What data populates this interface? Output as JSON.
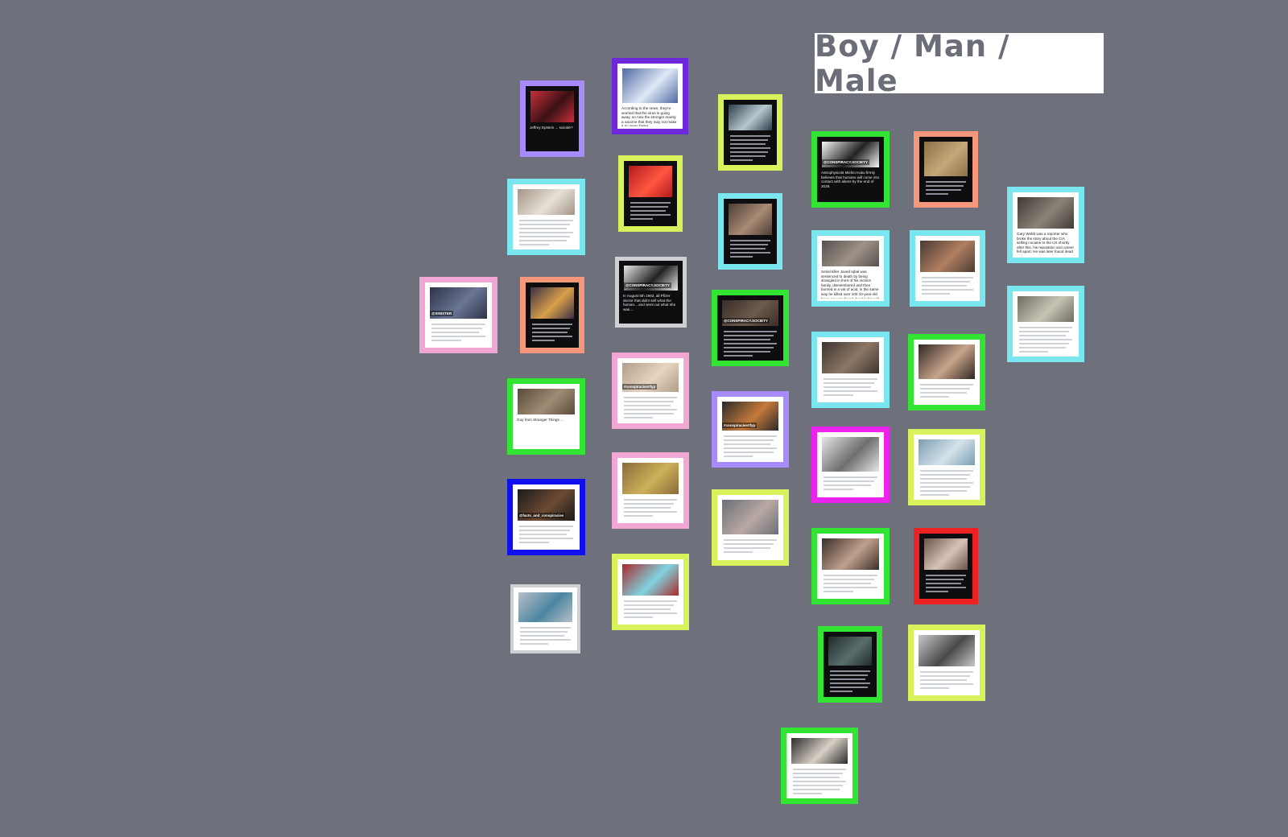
{
  "page": {
    "title": "Boy / Man / Male",
    "background": "#6e717b"
  },
  "cards": [
    {
      "id": "c1",
      "frame": "#a78bfa",
      "dark": true,
      "caption": "Jeffrey Epstein ... suicide?"
    },
    {
      "id": "c2",
      "frame": "#6d28d9",
      "dark": false,
      "caption": "According to the news, they're worried that the virus is going away, so now the stronger mainly a vaccine that they may not make it go away faster."
    },
    {
      "id": "c3",
      "frame": "#d9f25c",
      "dark": true,
      "caption": ""
    },
    {
      "id": "c4",
      "frame": "#79e6f0",
      "dark": false,
      "caption": ""
    },
    {
      "id": "c5",
      "frame": "#d9f25c",
      "dark": true,
      "caption": ""
    },
    {
      "id": "c6",
      "frame": "#79e6f0",
      "dark": true,
      "caption": ""
    },
    {
      "id": "c7",
      "frame": "#33e533",
      "dark": true,
      "caption": "Astrophysicist Michio Kaku firmly believes that humans will come into contact with aliens by the end of 2029.",
      "tag": "@CONSPIRACY.SOCIETY"
    },
    {
      "id": "c8",
      "frame": "#f5977a",
      "dark": true,
      "caption": ""
    },
    {
      "id": "c9",
      "frame": "#79e6f0",
      "dark": false,
      "caption": "Gary Webb was a reporter who broke the story about the CIA selling cocaine to the US shortly after this, his reputation and career fell apart. He was later found dead with two gunshots to the head. It was labeled as a suicide."
    },
    {
      "id": "c10",
      "frame": "#f2a6d4",
      "dark": false,
      "caption": "",
      "tag": "@SINISTER"
    },
    {
      "id": "c11",
      "frame": "#f5977a",
      "dark": true,
      "caption": ""
    },
    {
      "id": "c12",
      "frame": "#cfd0d4",
      "dark": true,
      "caption": "In August 5th 1963, all Pfizer doctor that didnt sell what the human... and went out what she was....",
      "tag": "@CONSPIRACY.SOCIETY"
    },
    {
      "id": "c13",
      "frame": "#33e533",
      "dark": true,
      "caption": "",
      "tag": "@CONSPIRACY.SOCIETY"
    },
    {
      "id": "c14",
      "frame": "#79e6f0",
      "dark": false,
      "caption": "Serial killer Javed Iqbal was sentenced to death by being strangled in front of his victims family, dismembered and then burned in a vat of acid, in the same way he killed over 100 10-year-old boys. He was found dead in his cell before the execution could be carried out."
    },
    {
      "id": "c15",
      "frame": "#79e6f0",
      "dark": false,
      "caption": ""
    },
    {
      "id": "c16",
      "frame": "#79e6f0",
      "dark": false,
      "caption": ""
    },
    {
      "id": "c17",
      "frame": "#33e533",
      "dark": false,
      "caption": "Guy from Stranger Things ..."
    },
    {
      "id": "c18",
      "frame": "#f2a6d4",
      "dark": false,
      "caption": "",
      "tag": "#conspiracies#fyp"
    },
    {
      "id": "c19",
      "frame": "#a78bfa",
      "dark": false,
      "caption": "",
      "tag": "#conspiracies#fyp"
    },
    {
      "id": "c20",
      "frame": "#79e6f0",
      "dark": false,
      "caption": ""
    },
    {
      "id": "c21",
      "frame": "#33e533",
      "dark": false,
      "caption": ""
    },
    {
      "id": "c22",
      "frame": "#1010ee",
      "dark": false,
      "caption": "",
      "tag": "@facts_and_conspiracies"
    },
    {
      "id": "c23",
      "frame": "#f2a6d4",
      "dark": false,
      "caption": ""
    },
    {
      "id": "c24",
      "frame": "#d9f25c",
      "dark": false,
      "caption": ""
    },
    {
      "id": "c25",
      "frame": "#ee22ee",
      "dark": false,
      "caption": ""
    },
    {
      "id": "c26",
      "frame": "#d9f25c",
      "dark": false,
      "caption": ""
    },
    {
      "id": "c27",
      "frame": "#d9f25c",
      "dark": false,
      "caption": ""
    },
    {
      "id": "c28",
      "frame": "#33e533",
      "dark": false,
      "caption": ""
    },
    {
      "id": "c29",
      "frame": "#ee2222",
      "dark": true,
      "caption": ""
    },
    {
      "id": "c30",
      "frame": "#cfd0d4",
      "dark": false,
      "caption": ""
    },
    {
      "id": "c31",
      "frame": "#d9f25c",
      "dark": false,
      "caption": ""
    },
    {
      "id": "c32",
      "frame": "#33e533",
      "dark": true,
      "caption": ""
    },
    {
      "id": "c33",
      "frame": "#33e533",
      "dark": false,
      "caption": ""
    },
    {
      "id": "c34",
      "frame": "#33e533",
      "dark": false,
      "caption": ""
    }
  ]
}
